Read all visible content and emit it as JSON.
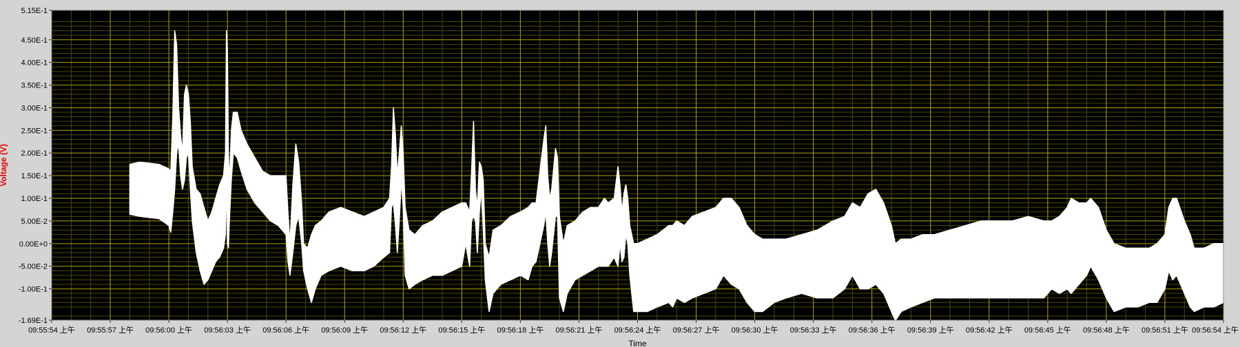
{
  "chart_data": {
    "type": "area",
    "title": "",
    "xlabel": "Time",
    "ylabel": "Voltage (V)",
    "ylim": [
      -0.169,
      0.515
    ],
    "grid": true,
    "colors": {
      "plot_background": "#000000",
      "grid_major": "#b3a600",
      "grid_minor": "#4c4a00",
      "trace": "#ffffff",
      "ylabel": "#e60000",
      "frame": "#d4d4d4"
    },
    "y_ticks": [
      {
        "value": 0.515,
        "label": "5.15E-1"
      },
      {
        "value": 0.45,
        "label": "4.50E-1"
      },
      {
        "value": 0.4,
        "label": "4.00E-1"
      },
      {
        "value": 0.35,
        "label": "3.50E-1"
      },
      {
        "value": 0.3,
        "label": "3.00E-1"
      },
      {
        "value": 0.25,
        "label": "2.50E-1"
      },
      {
        "value": 0.2,
        "label": "2.00E-1"
      },
      {
        "value": 0.15,
        "label": "1.50E-1"
      },
      {
        "value": 0.1,
        "label": "1.00E-1"
      },
      {
        "value": 0.05,
        "label": "5.00E-2"
      },
      {
        "value": 0.0,
        "label": "0.00E+0"
      },
      {
        "value": -0.05,
        "label": "-5.00E-2"
      },
      {
        "value": -0.1,
        "label": "-1.00E-1"
      },
      {
        "value": -0.169,
        "label": "-1.69E-1"
      }
    ],
    "x_ticks": [
      "09:55:54 上午",
      "09:55:57 上午",
      "09:56:00 上午",
      "09:56:03 上午",
      "09:56:06 上午",
      "09:56:09 上午",
      "09:56:12 上午",
      "09:56:15 上午",
      "09:56:18 上午",
      "09:56:21 上午",
      "09:56:24 上午",
      "09:56:27 上午",
      "09:56:30 上午",
      "09:56:33 上午",
      "09:56:36 上午",
      "09:56:39 上午",
      "09:56:42 上午",
      "09:56:45 上午",
      "09:56:48 上午",
      "09:56:51 上午",
      "09:56:54 上午"
    ],
    "x_range_seconds": [
      0,
      60
    ],
    "series": [
      {
        "points": [
          [
            4.0,
            0.065,
            0.175
          ],
          [
            4.5,
            0.06,
            0.18
          ],
          [
            5.5,
            0.055,
            0.175
          ],
          [
            6.0,
            0.04,
            0.165
          ],
          [
            6.1,
            0.025,
            0.16
          ],
          [
            6.2,
            0.07,
            0.28
          ],
          [
            6.3,
            0.12,
            0.47
          ],
          [
            6.4,
            0.2,
            0.44
          ],
          [
            6.5,
            0.22,
            0.3
          ],
          [
            6.6,
            0.15,
            0.24
          ],
          [
            6.7,
            0.12,
            0.2
          ],
          [
            6.8,
            0.14,
            0.33
          ],
          [
            6.9,
            0.19,
            0.35
          ],
          [
            7.0,
            0.2,
            0.33
          ],
          [
            7.1,
            0.12,
            0.27
          ],
          [
            7.2,
            0.05,
            0.17
          ],
          [
            7.4,
            -0.02,
            0.12
          ],
          [
            7.6,
            -0.06,
            0.11
          ],
          [
            7.8,
            -0.09,
            0.08
          ],
          [
            8.0,
            -0.08,
            0.05
          ],
          [
            8.2,
            -0.06,
            0.07
          ],
          [
            8.4,
            -0.04,
            0.1
          ],
          [
            8.6,
            -0.03,
            0.13
          ],
          [
            8.8,
            -0.01,
            0.15
          ],
          [
            8.9,
            0.02,
            0.2
          ],
          [
            8.95,
            0.15,
            0.47
          ],
          [
            9.0,
            0.0,
            0.43
          ],
          [
            9.05,
            -0.01,
            0.2
          ],
          [
            9.1,
            0.05,
            0.13
          ],
          [
            9.2,
            0.14,
            0.25
          ],
          [
            9.3,
            0.2,
            0.29
          ],
          [
            9.5,
            0.19,
            0.29
          ],
          [
            9.7,
            0.16,
            0.25
          ],
          [
            10.0,
            0.12,
            0.22
          ],
          [
            10.4,
            0.09,
            0.19
          ],
          [
            10.8,
            0.07,
            0.16
          ],
          [
            11.2,
            0.05,
            0.15
          ],
          [
            11.6,
            0.04,
            0.15
          ],
          [
            12.0,
            0.02,
            0.15
          ],
          [
            12.1,
            -0.04,
            0.07
          ],
          [
            12.2,
            -0.07,
            0.0
          ],
          [
            12.35,
            -0.02,
            0.13
          ],
          [
            12.5,
            0.04,
            0.22
          ],
          [
            12.65,
            0.06,
            0.18
          ],
          [
            12.8,
            0.0,
            0.09
          ],
          [
            12.9,
            -0.06,
            0.0
          ],
          [
            13.1,
            -0.1,
            -0.01
          ],
          [
            13.3,
            -0.13,
            0.02
          ],
          [
            13.5,
            -0.1,
            0.04
          ],
          [
            13.8,
            -0.07,
            0.05
          ],
          [
            14.2,
            -0.06,
            0.07
          ],
          [
            14.8,
            -0.05,
            0.08
          ],
          [
            15.4,
            -0.06,
            0.07
          ],
          [
            16.0,
            -0.06,
            0.06
          ],
          [
            16.5,
            -0.05,
            0.07
          ],
          [
            17.0,
            -0.03,
            0.08
          ],
          [
            17.3,
            -0.02,
            0.1
          ],
          [
            17.4,
            0.08,
            0.17
          ],
          [
            17.5,
            0.09,
            0.3
          ],
          [
            17.6,
            0.04,
            0.24
          ],
          [
            17.7,
            -0.02,
            0.15
          ],
          [
            17.8,
            0.05,
            0.2
          ],
          [
            17.9,
            0.14,
            0.26
          ],
          [
            18.0,
            0.08,
            0.2
          ],
          [
            18.1,
            -0.07,
            0.08
          ],
          [
            18.3,
            -0.1,
            0.03
          ],
          [
            18.6,
            -0.09,
            0.02
          ],
          [
            19.0,
            -0.08,
            0.04
          ],
          [
            19.5,
            -0.07,
            0.05
          ],
          [
            20.0,
            -0.07,
            0.07
          ],
          [
            20.5,
            -0.06,
            0.08
          ],
          [
            21.0,
            -0.05,
            0.09
          ],
          [
            21.2,
            0.0,
            0.09
          ],
          [
            21.4,
            -0.05,
            0.07
          ],
          [
            21.5,
            0.05,
            0.16
          ],
          [
            21.6,
            0.06,
            0.27
          ],
          [
            21.7,
            0.05,
            0.12
          ],
          [
            21.8,
            -0.02,
            0.08
          ],
          [
            21.9,
            0.07,
            0.18
          ],
          [
            22.0,
            0.12,
            0.17
          ],
          [
            22.1,
            0.03,
            0.14
          ],
          [
            22.2,
            -0.08,
            0.0
          ],
          [
            22.4,
            -0.15,
            -0.03
          ],
          [
            22.6,
            -0.11,
            0.03
          ],
          [
            23.0,
            -0.09,
            0.04
          ],
          [
            23.5,
            -0.08,
            0.06
          ],
          [
            24.0,
            -0.07,
            0.07
          ],
          [
            24.4,
            -0.08,
            0.08
          ],
          [
            24.6,
            -0.05,
            0.09
          ],
          [
            24.8,
            -0.04,
            0.09
          ],
          [
            25.2,
            0.04,
            0.23
          ],
          [
            25.3,
            0.07,
            0.26
          ],
          [
            25.4,
            0.0,
            0.15
          ],
          [
            25.5,
            -0.05,
            0.1
          ],
          [
            25.6,
            -0.02,
            0.12
          ],
          [
            25.8,
            0.06,
            0.21
          ],
          [
            25.9,
            0.06,
            0.19
          ],
          [
            26.0,
            -0.12,
            0.06
          ],
          [
            26.2,
            -0.15,
            0.0
          ],
          [
            26.4,
            -0.11,
            0.04
          ],
          [
            26.8,
            -0.08,
            0.05
          ],
          [
            27.2,
            -0.07,
            0.07
          ],
          [
            27.6,
            -0.06,
            0.08
          ],
          [
            28.0,
            -0.05,
            0.08
          ],
          [
            28.3,
            -0.05,
            0.1
          ],
          [
            28.5,
            -0.05,
            0.09
          ],
          [
            28.8,
            -0.03,
            0.1
          ],
          [
            29.0,
            -0.05,
            0.17
          ],
          [
            29.1,
            0.0,
            0.13
          ],
          [
            29.2,
            -0.04,
            0.07
          ],
          [
            29.3,
            -0.03,
            0.11
          ],
          [
            29.4,
            0.02,
            0.13
          ],
          [
            29.5,
            0.0,
            0.1
          ],
          [
            29.6,
            -0.07,
            0.04
          ],
          [
            29.8,
            -0.15,
            0.0
          ],
          [
            30.0,
            -0.15,
            0.0
          ],
          [
            30.5,
            -0.15,
            0.01
          ],
          [
            31.0,
            -0.14,
            0.02
          ],
          [
            31.6,
            -0.13,
            0.04
          ],
          [
            31.8,
            -0.14,
            0.04
          ],
          [
            32.0,
            -0.12,
            0.05
          ],
          [
            32.4,
            -0.13,
            0.04
          ],
          [
            32.8,
            -0.12,
            0.06
          ],
          [
            33.4,
            -0.11,
            0.07
          ],
          [
            34.0,
            -0.1,
            0.08
          ],
          [
            34.4,
            -0.07,
            0.1
          ],
          [
            34.8,
            -0.09,
            0.1
          ],
          [
            35.2,
            -0.1,
            0.08
          ],
          [
            35.6,
            -0.13,
            0.04
          ],
          [
            36.0,
            -0.15,
            0.02
          ],
          [
            36.4,
            -0.15,
            0.01
          ],
          [
            37.0,
            -0.13,
            0.01
          ],
          [
            37.6,
            -0.12,
            0.01
          ],
          [
            38.4,
            -0.11,
            0.02
          ],
          [
            39.2,
            -0.12,
            0.03
          ],
          [
            40.0,
            -0.12,
            0.05
          ],
          [
            40.6,
            -0.1,
            0.06
          ],
          [
            41.0,
            -0.07,
            0.09
          ],
          [
            41.4,
            -0.1,
            0.08
          ],
          [
            41.8,
            -0.1,
            0.11
          ],
          [
            42.2,
            -0.09,
            0.12
          ],
          [
            42.6,
            -0.11,
            0.09
          ],
          [
            43.0,
            -0.15,
            0.04
          ],
          [
            43.2,
            -0.17,
            0.0
          ],
          [
            43.5,
            -0.15,
            0.01
          ],
          [
            44.0,
            -0.14,
            0.01
          ],
          [
            44.6,
            -0.13,
            0.02
          ],
          [
            45.2,
            -0.12,
            0.02
          ],
          [
            46.0,
            -0.12,
            0.03
          ],
          [
            46.8,
            -0.12,
            0.04
          ],
          [
            47.6,
            -0.12,
            0.05
          ],
          [
            48.4,
            -0.12,
            0.05
          ],
          [
            49.2,
            -0.12,
            0.05
          ],
          [
            50.0,
            -0.12,
            0.06
          ],
          [
            50.8,
            -0.12,
            0.05
          ],
          [
            51.2,
            -0.1,
            0.05
          ],
          [
            51.6,
            -0.11,
            0.06
          ],
          [
            52.0,
            -0.1,
            0.08
          ],
          [
            52.2,
            -0.11,
            0.1
          ],
          [
            52.6,
            -0.09,
            0.09
          ],
          [
            53.0,
            -0.07,
            0.09
          ],
          [
            53.2,
            -0.05,
            0.1
          ],
          [
            53.6,
            -0.08,
            0.08
          ],
          [
            54.0,
            -0.12,
            0.03
          ],
          [
            54.4,
            -0.15,
            0.0
          ],
          [
            55.0,
            -0.14,
            -0.01
          ],
          [
            55.6,
            -0.14,
            -0.01
          ],
          [
            56.2,
            -0.13,
            -0.01
          ],
          [
            56.6,
            -0.13,
            0.0
          ],
          [
            57.0,
            -0.1,
            0.02
          ],
          [
            57.2,
            -0.06,
            0.08
          ],
          [
            57.4,
            -0.08,
            0.1
          ],
          [
            57.6,
            -0.07,
            0.1
          ],
          [
            58.0,
            -0.11,
            0.05
          ],
          [
            58.3,
            -0.14,
            0.02
          ],
          [
            58.5,
            -0.15,
            -0.01
          ],
          [
            59.0,
            -0.14,
            -0.01
          ],
          [
            59.5,
            -0.14,
            0.0
          ],
          [
            60.0,
            -0.13,
            0.0
          ]
        ]
      }
    ]
  }
}
